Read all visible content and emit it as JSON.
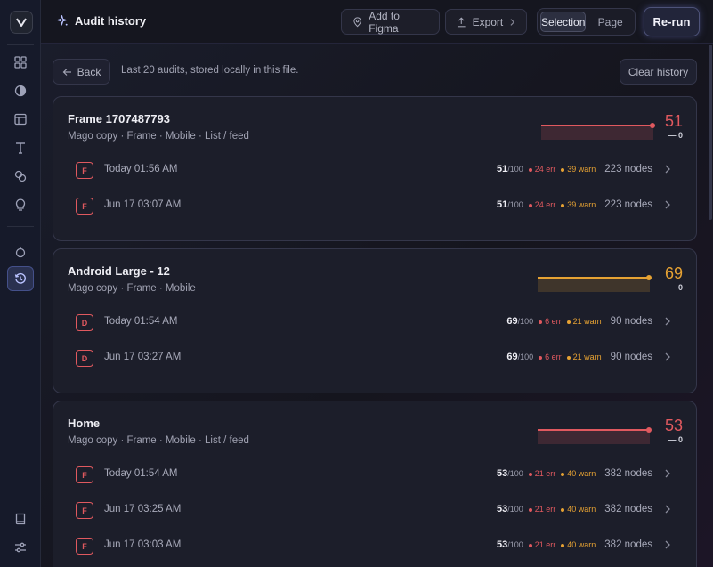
{
  "header": {
    "title": "Audit history",
    "add_to_figma": "Add to Figma",
    "export": "Export",
    "scope_selection": "Selection",
    "scope_page": "Page",
    "rerun": "Re-run"
  },
  "toolbar": {
    "back": "Back",
    "note": "Last 20 audits, stored locally in this file.",
    "clear": "Clear history"
  },
  "colors": {
    "error": "#e0595f",
    "warning": "#e6a233",
    "accent": "#4d5278"
  },
  "cards": [
    {
      "name": "Frame 1707487793",
      "tags": "Mago copy · Frame · Mobile · List / feed",
      "score": "51",
      "delta": "— 0",
      "trend_color": "#e0595f",
      "runs": [
        {
          "grade": "F",
          "date": "Today 01:56 AM",
          "score": "51",
          "of": "/100",
          "err": "24 err",
          "warn": "39 warn",
          "nodes": "223 nodes"
        },
        {
          "grade": "F",
          "date": "Jun 17 03:07 AM",
          "score": "51",
          "of": "/100",
          "err": "24 err",
          "warn": "39 warn",
          "nodes": "223 nodes"
        }
      ]
    },
    {
      "name": "Android Large - 12",
      "tags": "Mago copy · Frame · Mobile",
      "score": "69",
      "delta": "— 0",
      "trend_color": "#e6a233",
      "runs": [
        {
          "grade": "D",
          "date": "Today 01:54 AM",
          "score": "69",
          "of": "/100",
          "err": "6 err",
          "warn": "21 warn",
          "nodes": "90 nodes"
        },
        {
          "grade": "D",
          "date": "Jun 17 03:27 AM",
          "score": "69",
          "of": "/100",
          "err": "6 err",
          "warn": "21 warn",
          "nodes": "90 nodes"
        }
      ]
    },
    {
      "name": "Home",
      "tags": "Mago copy · Frame · Mobile · List / feed",
      "score": "53",
      "delta": "— 0",
      "trend_color": "#e0595f",
      "runs": [
        {
          "grade": "F",
          "date": "Today 01:54 AM",
          "score": "53",
          "of": "/100",
          "err": "21 err",
          "warn": "40 warn",
          "nodes": "382 nodes"
        },
        {
          "grade": "F",
          "date": "Jun 17 03:25 AM",
          "score": "53",
          "of": "/100",
          "err": "21 err",
          "warn": "40 warn",
          "nodes": "382 nodes"
        },
        {
          "grade": "F",
          "date": "Jun 17 03:03 AM",
          "score": "53",
          "of": "/100",
          "err": "21 err",
          "warn": "40 warn",
          "nodes": "382 nodes"
        }
      ]
    }
  ]
}
